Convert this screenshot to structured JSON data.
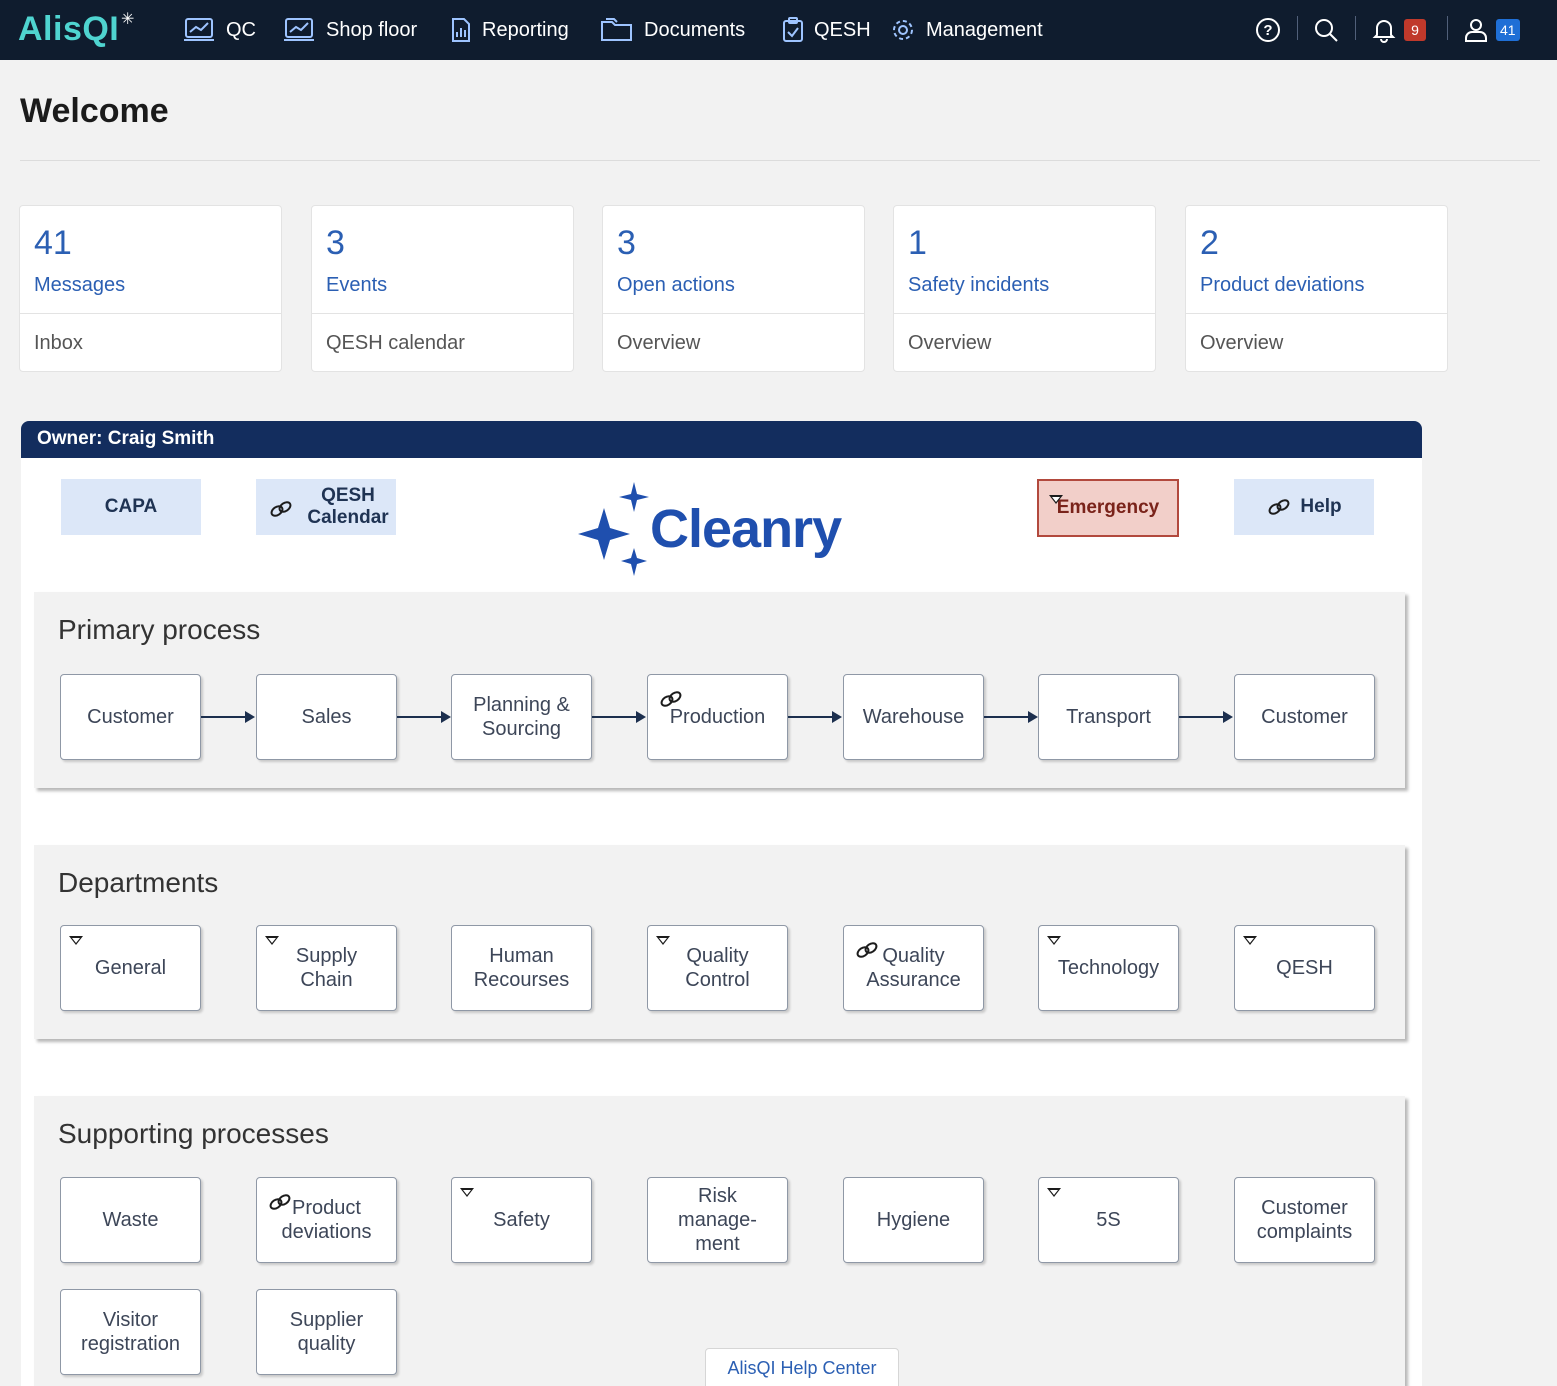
{
  "app": {
    "logo": "AlisQI"
  },
  "nav": {
    "items": [
      {
        "label": "QC",
        "icon": "chart-icon"
      },
      {
        "label": "Shop floor",
        "icon": "chart-icon"
      },
      {
        "label": "Reporting",
        "icon": "report-icon"
      },
      {
        "label": "Documents",
        "icon": "folder-icon"
      },
      {
        "label": "QESH",
        "icon": "clipboard-check-icon"
      },
      {
        "label": "Management",
        "icon": "gear-icon"
      }
    ],
    "notifications_count": "9",
    "messages_count": "41"
  },
  "page": {
    "title": "Welcome"
  },
  "cards": [
    {
      "count": "41",
      "label": "Messages",
      "footer": "Inbox"
    },
    {
      "count": "3",
      "label": "Events",
      "footer": "QESH calendar"
    },
    {
      "count": "3",
      "label": "Open actions",
      "footer": "Overview"
    },
    {
      "count": "1",
      "label": "Safety incidents",
      "footer": "Overview"
    },
    {
      "count": "2",
      "label": "Product deviations",
      "footer": "Overview"
    }
  ],
  "dashboard": {
    "owner": "Owner: Craig Smith",
    "brand": "Cleanry",
    "top_buttons": {
      "capa": "CAPA",
      "qesh_calendar": "QESH Calendar",
      "emergency": "Emergency",
      "help": "Help"
    },
    "primary": {
      "title": "Primary process",
      "steps": [
        "Customer",
        "Sales",
        "Planning & Sourcing",
        "Production",
        "Warehouse",
        "Transport",
        "Customer"
      ]
    },
    "departments": {
      "title": "Departments",
      "items": [
        "General",
        "Supply Chain",
        "Human Recourses",
        "Quality Control",
        "Quality Assurance",
        "Technology",
        "QESH"
      ]
    },
    "supporting": {
      "title": "Supporting processes",
      "items": [
        "Waste",
        "Product deviations",
        "Safety",
        "Risk manage-ment",
        "Hygiene",
        "5S",
        "Customer complaints",
        "Visitor registration",
        "Supplier quality"
      ]
    }
  },
  "help_center": "AlisQI Help Center",
  "colors": {
    "nav_bg": "#0f1c2e",
    "accent": "#2b5fb3",
    "owner_bar": "#132d5e",
    "logo": "#4fd4d0"
  }
}
